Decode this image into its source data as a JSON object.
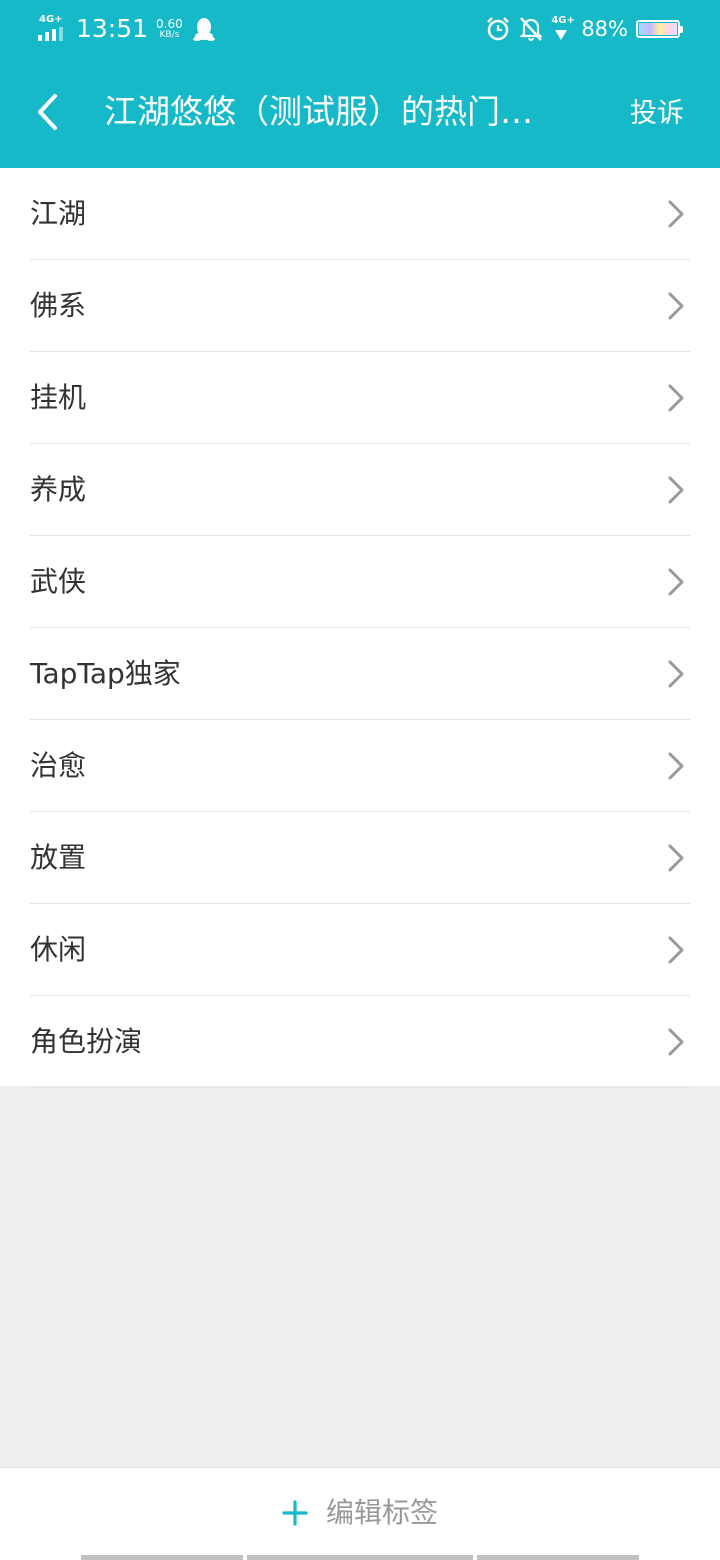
{
  "status_bar": {
    "network_left": "4G+",
    "time": "13:51",
    "speed_value": "0.60",
    "speed_unit": "KB/s",
    "network_right": "4G+",
    "battery_percent": "88%"
  },
  "header": {
    "title": "江湖悠悠（测试服）的热门…",
    "report_label": "投诉"
  },
  "tags": [
    {
      "label": "江湖"
    },
    {
      "label": "佛系"
    },
    {
      "label": "挂机"
    },
    {
      "label": "养成"
    },
    {
      "label": "武侠"
    },
    {
      "label": "TapTap独家"
    },
    {
      "label": "治愈"
    },
    {
      "label": "放置"
    },
    {
      "label": "休闲"
    },
    {
      "label": "角色扮演"
    }
  ],
  "bottom": {
    "edit_label": "编辑标签"
  },
  "colors": {
    "accent": "#15b9c8",
    "background": "#eeeeee",
    "list_bg": "#ffffff",
    "text": "#333333",
    "chevron": "#999999",
    "muted": "#999999"
  },
  "icons": {
    "back": "chevron-left-icon",
    "row": "chevron-right-icon",
    "add": "plus-icon",
    "alarm": "alarm-icon",
    "mute": "bell-off-icon",
    "qq": "qq-icon",
    "battery": "battery-icon"
  }
}
